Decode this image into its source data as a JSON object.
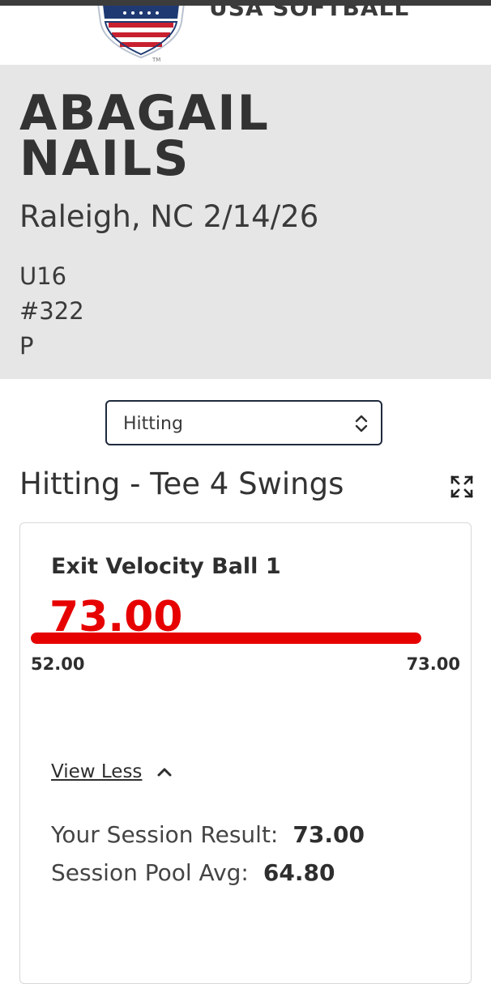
{
  "header": {
    "brand": "USA SOFTBALL",
    "trademark": "TM"
  },
  "athlete": {
    "first_name": "ABAGAIL",
    "last_name": "NAILS",
    "location_date": "Raleigh, NC 2/14/26",
    "age_group": "U16",
    "number": "#322",
    "position": "P"
  },
  "category_select": {
    "selected": "Hitting"
  },
  "section": {
    "title": "Hitting - Tee 4 Swings"
  },
  "metric": {
    "label": "Exit Velocity Ball 1",
    "value": "73.00",
    "view_toggle": "View Less",
    "session_result_label": "Your Session Result:",
    "session_result_value": "73.00",
    "pool_avg_label": "Session Pool Avg:",
    "pool_avg_value": "64.80",
    "range_min": "52.00",
    "range_max": "73.00",
    "bar_fill_fraction": 1.0
  },
  "colors": {
    "accent_red": "#e60000",
    "profile_bg": "#e6e6e6",
    "navy": "#1f2b3d"
  }
}
